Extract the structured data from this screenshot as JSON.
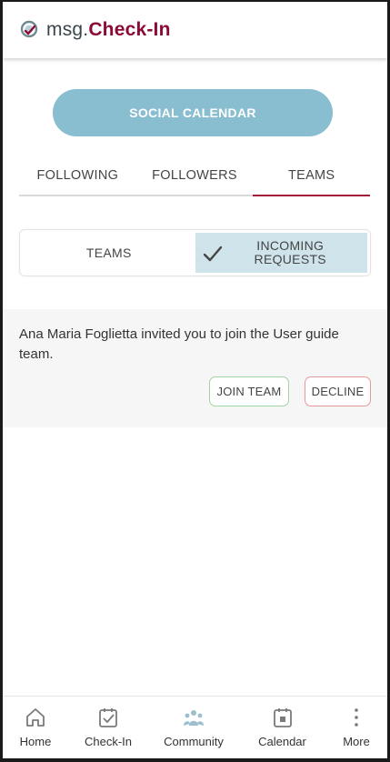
{
  "app": {
    "logo_prefix": "msg.",
    "logo_brand": "Check-In"
  },
  "social_calendar_label": "SOCIAL CALENDAR",
  "tabs": [
    {
      "label": "FOLLOWING",
      "active": false
    },
    {
      "label": "FOLLOWERS",
      "active": false
    },
    {
      "label": "TEAMS",
      "active": true
    }
  ],
  "segments": [
    {
      "label": "TEAMS",
      "active": false
    },
    {
      "label": "INCOMING REQUESTS",
      "active": true
    }
  ],
  "invitation": {
    "text": "Ana Maria Foglietta invited you to join the User guide team.",
    "join_label": "JOIN TEAM",
    "decline_label": "DECLINE"
  },
  "bottom_nav": [
    {
      "label": "Home",
      "icon": "home-icon"
    },
    {
      "label": "Check-In",
      "icon": "checkin-icon"
    },
    {
      "label": "Community",
      "icon": "community-icon"
    },
    {
      "label": "Calendar",
      "icon": "calendar-icon"
    },
    {
      "label": "More",
      "icon": "more-icon"
    }
  ],
  "colors": {
    "brand": "#8c0b36",
    "accent_button": "#89bdd0",
    "active_segment": "#cfe3ea",
    "tab_underline": "#a31c3c",
    "join_border": "#9fd5a0",
    "decline_border": "#e59a9a"
  }
}
